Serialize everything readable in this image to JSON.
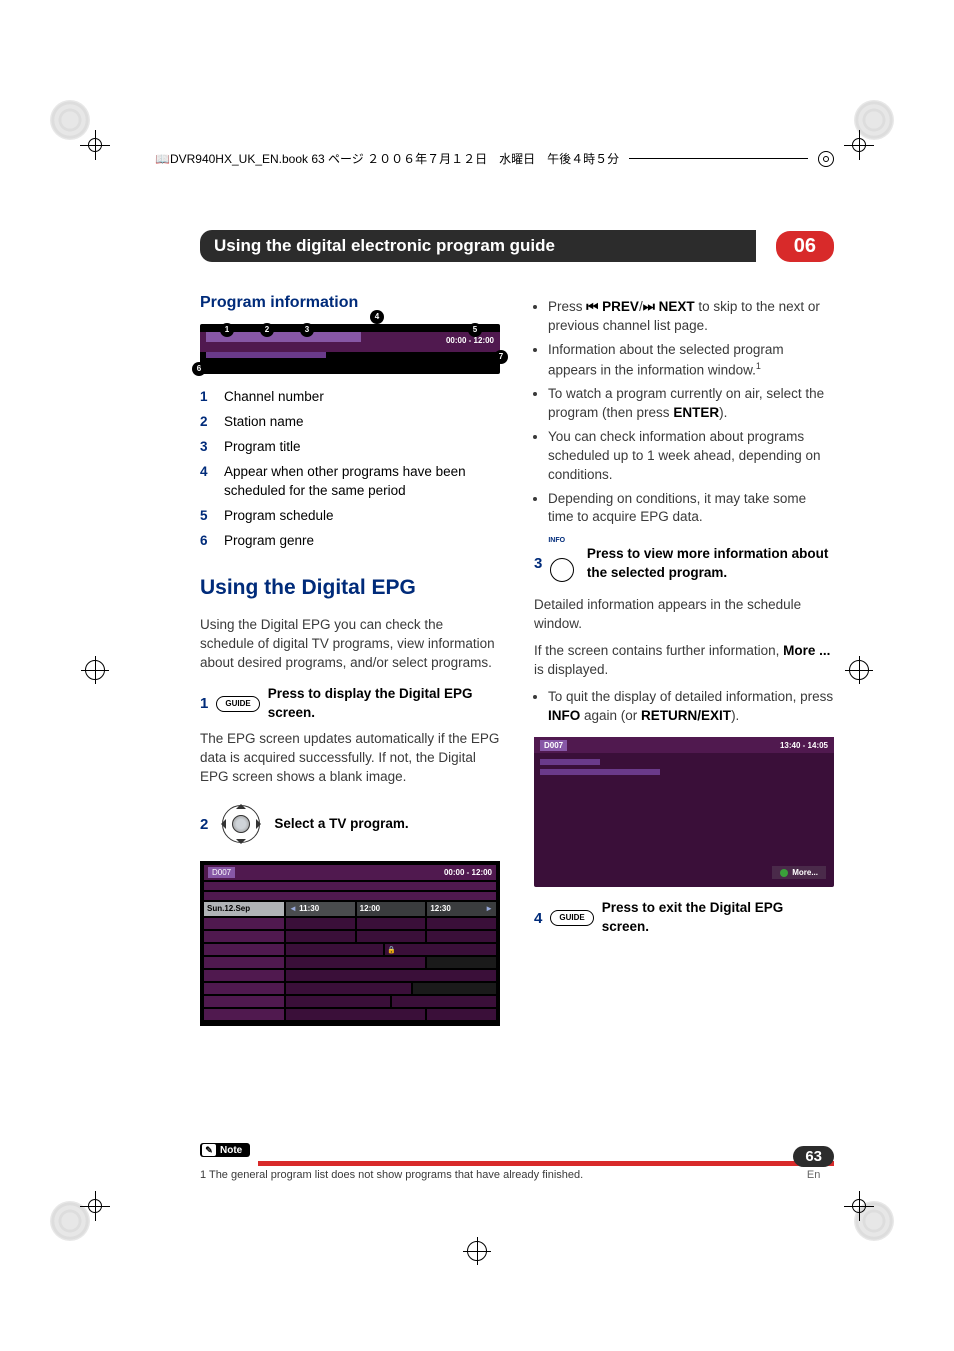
{
  "header_line": "DVR940HX_UK_EN.book  63 ページ  ２００６年７月１２日　水曜日　午後４時５分",
  "chapter": {
    "title": "Using the digital electronic program guide",
    "number": "06"
  },
  "left": {
    "h2": "Program information",
    "time_tag": "00:00 - 12:00",
    "callouts": [
      "1",
      "2",
      "3",
      "4",
      "5",
      "6",
      "7"
    ],
    "items": [
      {
        "n": "1",
        "t": "Channel number"
      },
      {
        "n": "2",
        "t": "Station name"
      },
      {
        "n": "3",
        "t": "Program title"
      },
      {
        "n": "4",
        "t": "Appear when other programs have been scheduled for the same period"
      },
      {
        "n": "5",
        "t": "Program schedule"
      },
      {
        "n": "6",
        "t": "Program genre"
      }
    ],
    "epg_heading": "Using the Digital EPG",
    "epg_intro": "Using the Digital EPG you can check the schedule of digital TV programs, view information about desired programs, and/or select programs.",
    "step1_num": "1",
    "step1_btn": "GUIDE",
    "step1_head": "Press to display the Digital EPG screen.",
    "step1_body": "The EPG screen updates automatically if the EPG data is acquired successfully. If not, the Digital EPG screen shows a blank image.",
    "step2_num": "2",
    "step2_head": "Select a TV program.",
    "grid": {
      "channel": "D007",
      "time": "00:00 - 12:00",
      "date_label": "Sun.12.Sep",
      "cols": [
        "11:30",
        "12:00",
        "12:30"
      ]
    }
  },
  "right": {
    "bullets1": [
      {
        "pre": "Press ",
        "bold1": "⏮ PREV",
        "mid": "/",
        "bold2": "⏭ NEXT",
        "post": " to skip to the next or previous channel list page."
      },
      {
        "text": "Information about the selected program appears in the information window.",
        "sup": "1"
      },
      {
        "pre": "To watch a program currently on air, select the program (then press ",
        "bold": "ENTER",
        "post": ")."
      },
      {
        "text": "You can check information about programs scheduled up to 1 week ahead, depending on conditions."
      },
      {
        "text": "Depending on conditions, it may take some time to acquire EPG data."
      }
    ],
    "step3_num": "3",
    "step3_info_label": "INFO",
    "step3_head": "Press to view more information about the selected program.",
    "step3_body": "Detailed information appears in the schedule window.",
    "step3_more_pre": "If the screen contains further information, ",
    "step3_more_bold": "More ...",
    "step3_more_post": " is displayed.",
    "bullet_quit_pre": "To quit the display of detailed information, press ",
    "bullet_quit_bold1": "INFO",
    "bullet_quit_mid": " again (or ",
    "bullet_quit_bold2": "RETURN/EXIT",
    "bullet_quit_post": ").",
    "info_sshot": {
      "channel": "D007",
      "time": "13:40 - 14:05",
      "more": "More..."
    },
    "step4_num": "4",
    "step4_btn": "GUIDE",
    "step4_head": "Press to exit the Digital EPG screen."
  },
  "footnote": {
    "label": "Note",
    "text": "1 The general program list does not show programs that have already finished."
  },
  "page_number": "63",
  "lang": "En"
}
